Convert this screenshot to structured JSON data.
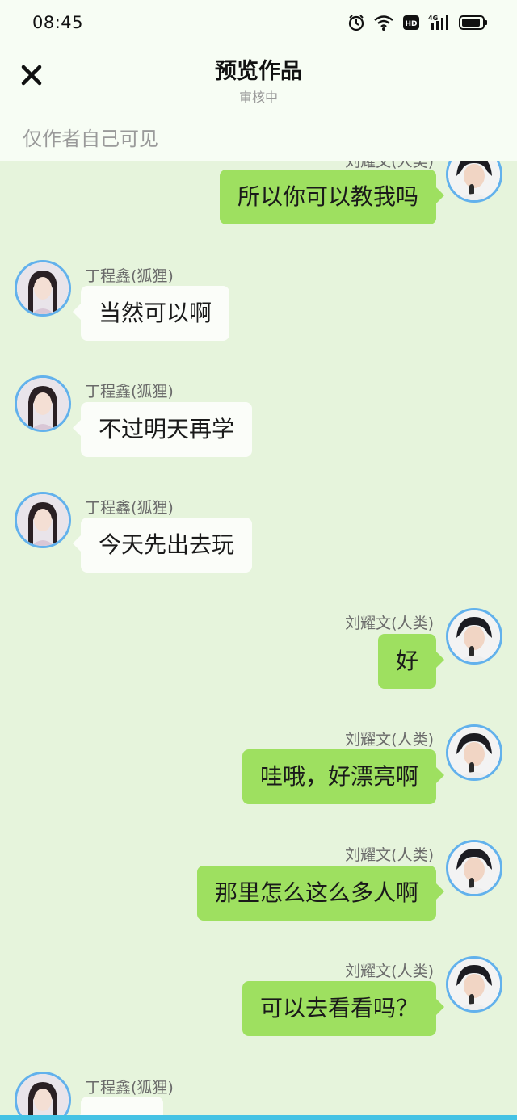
{
  "status": {
    "time": "08:45",
    "hd_label": "HD",
    "network_label": "4G"
  },
  "header": {
    "title": "预览作品",
    "subtitle": "审核中",
    "visibility_note": "仅作者自己可见",
    "close_icon": "close-icon"
  },
  "characters": {
    "fox": {
      "name": "丁程鑫(狐狸)",
      "avatar_icon": "avatar-fox"
    },
    "human": {
      "name": "刘耀文(人类)",
      "avatar_icon": "avatar-human"
    }
  },
  "messages": [
    {
      "sender": "刘耀文(人类)",
      "side": "right",
      "text": "所以你可以教我吗"
    },
    {
      "sender": "丁程鑫(狐狸)",
      "side": "left",
      "text": "当然可以啊"
    },
    {
      "sender": "丁程鑫(狐狸)",
      "side": "left",
      "text": "不过明天再学"
    },
    {
      "sender": "丁程鑫(狐狸)",
      "side": "left",
      "text": "今天先出去玩"
    },
    {
      "sender": "刘耀文(人类)",
      "side": "right",
      "text": "好"
    },
    {
      "sender": "刘耀文(人类)",
      "side": "right",
      "text": "哇哦，好漂亮啊"
    },
    {
      "sender": "刘耀文(人类)",
      "side": "right",
      "text": "那里怎么这么多人啊"
    },
    {
      "sender": "刘耀文(人类)",
      "side": "right",
      "text": "可以去看看吗？"
    },
    {
      "sender": "丁程鑫(狐狸)",
      "side": "left",
      "text": ""
    }
  ],
  "colors": {
    "chat_background": "#e6f4dc",
    "right_bubble": "#9ee060",
    "left_bubble": "#fbfdf9",
    "avatar_ring": "#62b1ec",
    "bottom_accent": "#44c2e4"
  }
}
